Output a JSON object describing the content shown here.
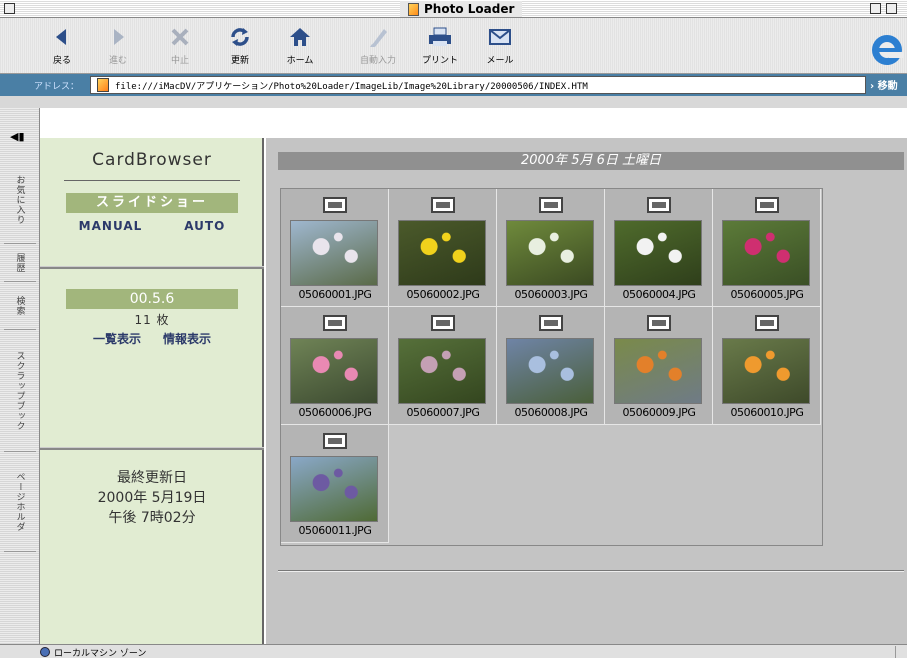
{
  "window": {
    "title": "Photo Loader"
  },
  "toolbar": {
    "buttons": [
      {
        "label": "戻る",
        "icon": "back-arrow-icon",
        "enabled": true
      },
      {
        "label": "進む",
        "icon": "forward-arrow-icon",
        "enabled": false
      },
      {
        "label": "中止",
        "icon": "stop-icon",
        "enabled": false
      },
      {
        "label": "更新",
        "icon": "refresh-icon",
        "enabled": true
      },
      {
        "label": "ホーム",
        "icon": "home-icon",
        "enabled": true
      },
      {
        "label": "自動入力",
        "icon": "autofill-icon",
        "enabled": false
      },
      {
        "label": "プリント",
        "icon": "print-icon",
        "enabled": true
      },
      {
        "label": "メール",
        "icon": "mail-icon",
        "enabled": true
      }
    ]
  },
  "address": {
    "label": "アドレス：",
    "url": "file:///iMacDV/アプリケーション/Photo%20Loader/ImageLib/Image%20Library/20000506/INDEX.HTM",
    "go_label": "移動"
  },
  "sidetabs": [
    "お気に入り",
    "履歴",
    "検索",
    "スクラップブック",
    "ページホルダ"
  ],
  "sidebar": {
    "app_title": "CardBrowser",
    "slideshow_label": "スライドショー",
    "manual_label": "MANUAL",
    "auto_label": "AUTO",
    "date_badge": "00.5.6",
    "count": "11 枚",
    "list_view_label": "一覧表示",
    "info_view_label": "情報表示",
    "last_updated_label": "最終更新日",
    "last_updated_date": "2000年 5月19日",
    "last_updated_time": "午後 7時02分"
  },
  "content": {
    "date_header": "2000年 5月 6日 土曜日",
    "photos": [
      {
        "filename": "05060001.JPG",
        "palette": [
          "#9fb7cf",
          "#e9e4ec",
          "#5a6a48"
        ]
      },
      {
        "filename": "05060002.JPG",
        "palette": [
          "#4b5a2b",
          "#f1d21c",
          "#2e3a1a"
        ]
      },
      {
        "filename": "05060003.JPG",
        "palette": [
          "#6f8a3c",
          "#e8efe0",
          "#3b4a22"
        ]
      },
      {
        "filename": "05060004.JPG",
        "palette": [
          "#4f6b2c",
          "#f2f2f2",
          "#2f3f1b"
        ]
      },
      {
        "filename": "05060005.JPG",
        "palette": [
          "#5c7b39",
          "#cf2f70",
          "#3a4f25"
        ]
      },
      {
        "filename": "05060006.JPG",
        "palette": [
          "#6f8356",
          "#e989b3",
          "#3c4a30"
        ]
      },
      {
        "filename": "05060007.JPG",
        "palette": [
          "#56703a",
          "#c4a0b4",
          "#34461f"
        ]
      },
      {
        "filename": "05060008.JPG",
        "palette": [
          "#6f84a6",
          "#a9bfdf",
          "#4a5f3a"
        ]
      },
      {
        "filename": "05060009.JPG",
        "palette": [
          "#7a8a4a",
          "#e3802a",
          "#6f7b86"
        ]
      },
      {
        "filename": "05060010.JPG",
        "palette": [
          "#697a4a",
          "#ef9a2e",
          "#3e4a2a"
        ]
      },
      {
        "filename": "05060011.JPG",
        "palette": [
          "#8aa8c8",
          "#6d5aa2",
          "#4f6a35"
        ]
      }
    ]
  },
  "statusbar": {
    "text": "ローカルマシン ゾーン"
  }
}
